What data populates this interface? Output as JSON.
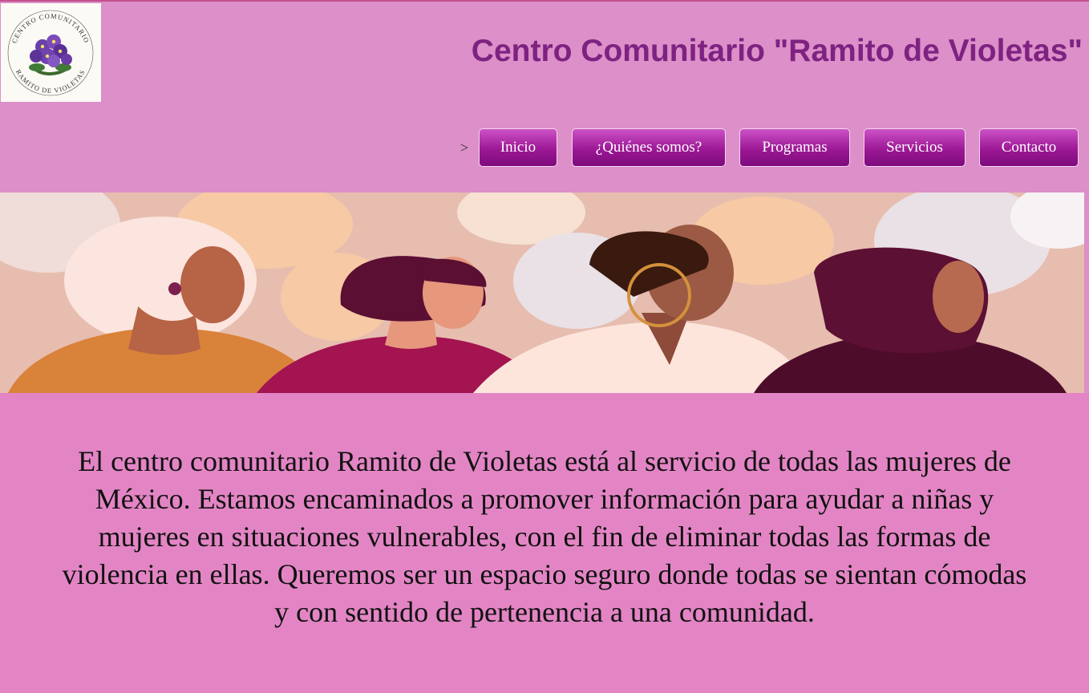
{
  "header": {
    "logo_alt": "Logotipo Centro Comunitario Ramito de Violetas",
    "logo_ring_top": "CENTRO COMUNITARIO",
    "logo_ring_bottom": "RAMITO DE VIOLETAS",
    "title": "Centro Comunitario \"Ramito de Violetas\""
  },
  "nav": {
    "marker": ">",
    "items": [
      {
        "label": "Inicio"
      },
      {
        "label": "¿Quiénes somos?"
      },
      {
        "label": "Programas"
      },
      {
        "label": "Servicios"
      },
      {
        "label": "Contacto"
      }
    ]
  },
  "main": {
    "banner_alt": "Ilustración de cuatro mujeres diversas",
    "mission": "El centro comunitario Ramito de Violetas está al servicio de todas las mujeres de México. Estamos encaminados a promover información para ayudar a niñas y mujeres en situaciones vulnerables, con el fin de eliminar todas las formas de violencia en ellas. Queremos ser un espacio seguro donde todas se sientan cómodas y con sentido de pertenencia a una comunidad."
  },
  "colors": {
    "header_bg": "#dc8fc8",
    "content_bg": "#e385c5",
    "title": "#7e2282",
    "button": "#9c1895"
  }
}
